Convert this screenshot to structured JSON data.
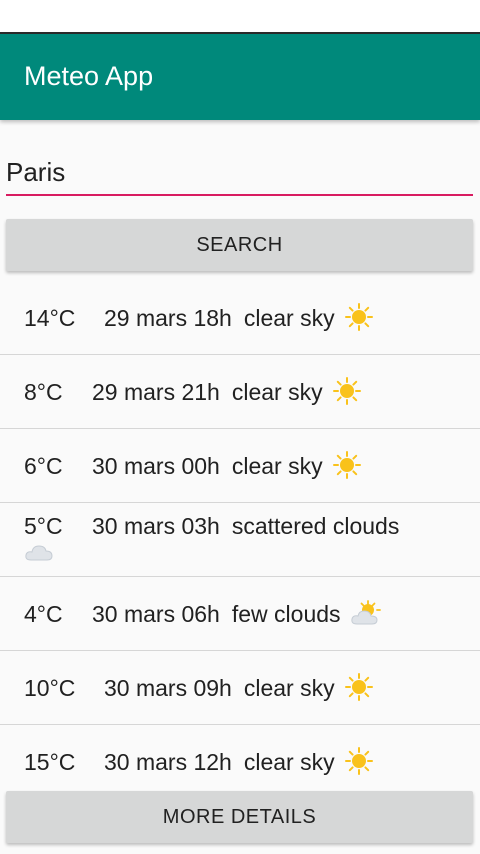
{
  "app": {
    "title": "Meteo App"
  },
  "search": {
    "value": "Paris",
    "button_label": "SEARCH"
  },
  "forecasts": [
    {
      "temp": "14°C",
      "date": "29 mars 18h",
      "desc": "clear sky",
      "icon": "sun-icon"
    },
    {
      "temp": "8°C",
      "date": "29 mars 21h",
      "desc": "clear sky",
      "icon": "sun-icon"
    },
    {
      "temp": "6°C",
      "date": "30 mars 00h",
      "desc": "clear sky",
      "icon": "sun-icon"
    },
    {
      "temp": "5°C",
      "date": "30 mars 03h",
      "desc": "scattered clouds",
      "icon": "cloud-icon"
    },
    {
      "temp": "4°C",
      "date": "30 mars 06h",
      "desc": "few clouds",
      "icon": "sun-cloud-icon"
    },
    {
      "temp": "10°C",
      "date": "30 mars 09h",
      "desc": "clear sky",
      "icon": "sun-icon"
    },
    {
      "temp": "15°C",
      "date": "30 mars 12h",
      "desc": "clear sky",
      "icon": "sun-icon"
    }
  ],
  "footer": {
    "details_label": "MORE DETAILS"
  },
  "colors": {
    "app_bar": "#00897b",
    "input_underline": "#d81b60",
    "button_bg": "#d6d7d7",
    "sun": "#f9c21b"
  }
}
